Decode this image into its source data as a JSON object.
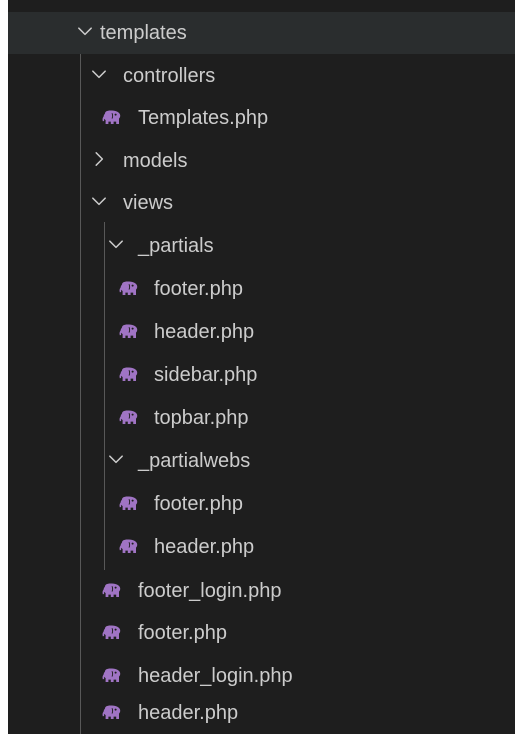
{
  "explorer": {
    "root": {
      "label": "templates",
      "icon": "chevron-down-icon"
    },
    "controllers": {
      "label": "controllers",
      "icon": "chevron-down-icon",
      "files": [
        {
          "label": "Templates.php",
          "icon": "php-elephant-icon"
        }
      ]
    },
    "models": {
      "label": "models",
      "icon": "chevron-right-icon"
    },
    "views": {
      "label": "views",
      "icon": "chevron-down-icon",
      "partials": {
        "label": "_partials",
        "icon": "chevron-down-icon",
        "files": [
          {
            "label": "footer.php",
            "icon": "php-elephant-icon"
          },
          {
            "label": "header.php",
            "icon": "php-elephant-icon"
          },
          {
            "label": "sidebar.php",
            "icon": "php-elephant-icon"
          },
          {
            "label": "topbar.php",
            "icon": "php-elephant-icon"
          }
        ]
      },
      "partialwebs": {
        "label": "_partialwebs",
        "icon": "chevron-down-icon",
        "files": [
          {
            "label": "footer.php",
            "icon": "php-elephant-icon"
          },
          {
            "label": "header.php",
            "icon": "php-elephant-icon"
          }
        ]
      },
      "files": [
        {
          "label": "footer_login.php",
          "icon": "php-elephant-icon"
        },
        {
          "label": "footer.php",
          "icon": "php-elephant-icon"
        },
        {
          "label": "header_login.php",
          "icon": "php-elephant-icon"
        },
        {
          "label": "header.php",
          "icon": "php-elephant-icon"
        }
      ]
    }
  },
  "colors": {
    "background": "#1e1e1e",
    "selected_row": "#2a2d2e",
    "text": "#cccccc",
    "php_icon": "#a074c4",
    "indent_guide": "#585858"
  }
}
